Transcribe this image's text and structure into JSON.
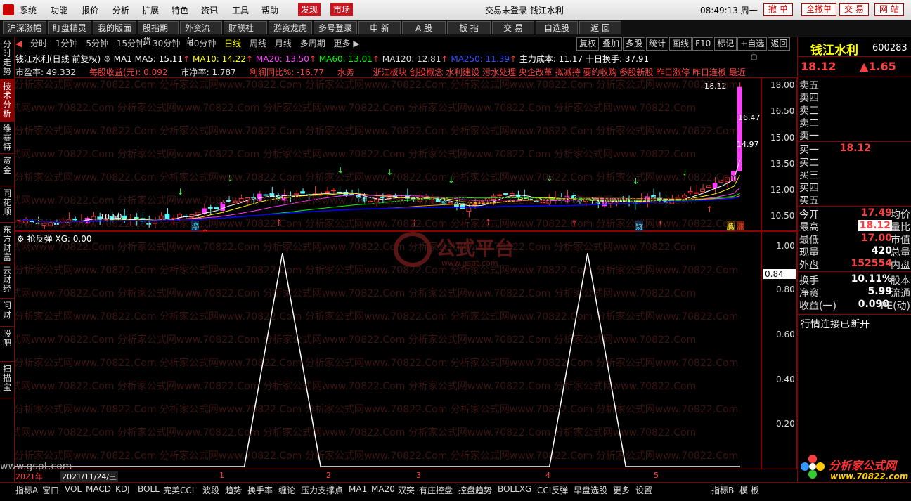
{
  "menu": {
    "items": [
      "系统",
      "功能",
      "报价",
      "分析",
      "扩展",
      "特色",
      "资讯",
      "工具",
      "帮助"
    ],
    "highlight": [
      "发现",
      "市场"
    ],
    "title": "交易未登录  钱江水利",
    "clock": "08:49:13 周一",
    "right_buttons": [
      "撤 单",
      "全撤单",
      "交 易",
      "网 站"
    ]
  },
  "toolbar": {
    "items": [
      "沪深涨幅",
      "盯盘精灵",
      "我的版面",
      "股指期货",
      "外资流向",
      "财联社",
      "游资龙虎",
      "多号登录",
      "申  新",
      "A 股",
      "板  指",
      "交  易",
      "自选股",
      "返  回"
    ]
  },
  "left_tabs": [
    "分时走势",
    "技术分析",
    "维赛特",
    "资金",
    "同花顺",
    "东方财富",
    "云财经",
    "问财",
    "股吧",
    "扫描宝"
  ],
  "period": {
    "items": [
      "分时",
      "1分钟",
      "5分钟",
      "15分钟",
      "30分钟",
      "60分钟",
      "日线",
      "周线",
      "月线",
      "多周期",
      "更多 ▶"
    ],
    "active": "日线",
    "right_buttons": [
      "复权",
      "叠加",
      "多股",
      "统计",
      "画线",
      "F10",
      "标记",
      "+自选",
      "返回"
    ]
  },
  "ma_line": {
    "name": "钱江水利(日线 前复权)",
    "ma1": "MA1",
    "ma5": "MA5: 15.11",
    "ma10": "MA10: 14.22",
    "ma20": "MA20: 13.50",
    "ma60": "MA60: 13.01",
    "ma120": "MA120: 12.81",
    "ma250": "MA250: 11.39",
    "cost": "主力成本: 11.17",
    "turnover": "十日换手: 37.91"
  },
  "info_line": {
    "pe": "市盈率:  49.332",
    "eps": "每股收益(元):  0.092",
    "pb": "市净率:  1.787",
    "profit": "利润同比%: -16.77",
    "sector": "水务",
    "concepts": "浙江板块 创投概念 水利建设 污水处理 央企改革  拟减持 要约收购 参股新股 昨日涨停 昨日连板 最近"
  },
  "main_chart": {
    "yticks": [
      "18.00",
      "16.50",
      "15.00",
      "13.50",
      "12.00",
      "10.50"
    ],
    "labels": {
      "high": "18.12",
      "mid": "16.47",
      "low": "14.97",
      "min": "10.50"
    },
    "markers": [
      "停",
      "财",
      "腾",
      "涨"
    ]
  },
  "sub_chart": {
    "title": "抢反弹  XG: 0.00",
    "yticks": [
      "1.00",
      "0.84",
      "0.80",
      "0.60",
      "0.40",
      "0.20"
    ],
    "watermark_title": "公式平台",
    "watermark_url": "www.gspt.com",
    "watermark_text": "分析家公式网www.70822.Com",
    "date": "2021/11/24/三",
    "year": "2021年",
    "months": [
      "1",
      "2",
      "3",
      "4",
      "5"
    ]
  },
  "chart_data": {
    "type": "line",
    "title": "抢反弹",
    "series": [
      {
        "name": "XG",
        "values": [
          0,
          0,
          0,
          0,
          0,
          0,
          0,
          1,
          0,
          0,
          0,
          0,
          0,
          0,
          0,
          1,
          0,
          0,
          0,
          0
        ]
      }
    ],
    "ylim": [
      0,
      1.05
    ]
  },
  "quote": {
    "name": "钱江水利",
    "code": "600283",
    "price": "18.12",
    "change": "▲1.65",
    "asks": [
      "卖五",
      "卖四",
      "卖三",
      "卖二",
      "卖一"
    ],
    "bids": [
      {
        "k": "买一",
        "v": "18.12"
      },
      {
        "k": "买二",
        "v": ""
      },
      {
        "k": "买三",
        "v": ""
      },
      {
        "k": "买四",
        "v": ""
      },
      {
        "k": "买五",
        "v": ""
      }
    ],
    "stats": [
      {
        "k": "今开",
        "v": "17.49",
        "k2": "均价"
      },
      {
        "k": "最高",
        "v": "18.12",
        "k2": "量比"
      },
      {
        "k": "最低",
        "v": "17.00",
        "k2": "市值"
      },
      {
        "k": "现量",
        "v": "420",
        "k2": "总量"
      },
      {
        "k": "外盘",
        "v": "152554",
        "k2": "内盘"
      },
      {
        "k": "换手",
        "v": "10.11%",
        "k2": "股本"
      },
      {
        "k": "净资",
        "v": "5.99",
        "k2": "流通"
      },
      {
        "k": "收益(一)",
        "v": "0.090",
        "k2": "PE(动)"
      }
    ],
    "status": "行情连接已断开",
    "brand": "分析家公式网",
    "brand_url": "www.70822.com"
  },
  "bottom": {
    "items": [
      "指标A",
      "窗口",
      "VOL",
      "MACD",
      "KDJ",
      "BOLL",
      "完美CCI",
      "波段",
      "趋势",
      "换手率",
      "缠论",
      "压力支撑点",
      "MA1",
      "MA20",
      "双突",
      "有庄控盘",
      "控盘趋势",
      "BOLLXG",
      "CCI反弹",
      "早盘选股",
      "更多",
      "设置"
    ],
    "right": [
      "指标B",
      "模 板"
    ]
  },
  "colors": {
    "up": "#ff3232",
    "down": "#54ffff",
    "bull_body": "#ff3cff",
    "ma5": "#ffffff",
    "ma10": "#ffff00",
    "ma20": "#ff3cff",
    "ma60": "#00ff00",
    "ma120": "#ffa000",
    "ma250": "#0000ff"
  }
}
